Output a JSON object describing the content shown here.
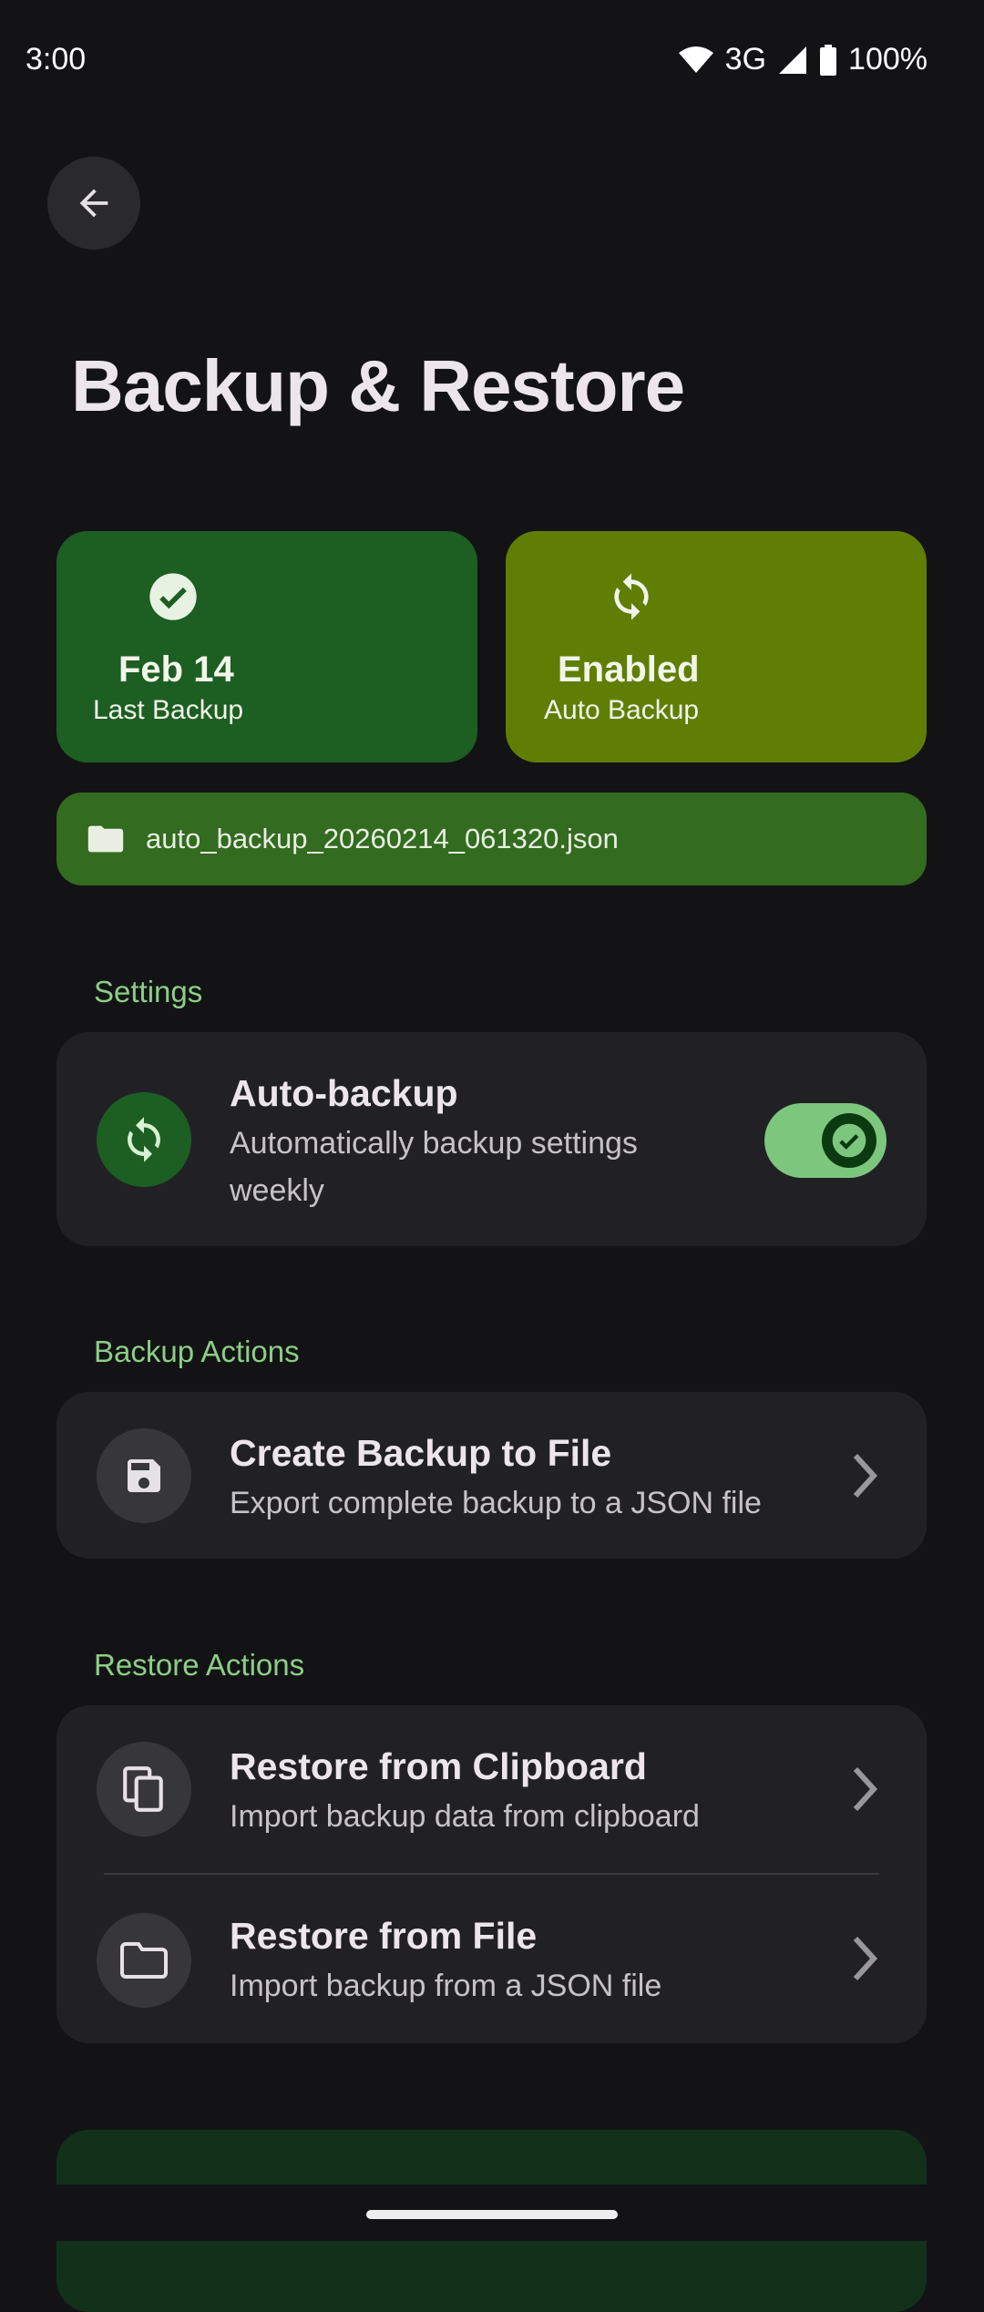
{
  "status_bar": {
    "time": "3:00",
    "network": "3G",
    "battery": "100%"
  },
  "header": {
    "title": "Backup & Restore"
  },
  "stats": {
    "last_backup": {
      "value": "Feb 14",
      "label": "Last Backup",
      "icon": "check-circle-icon",
      "color": "#1d5e22"
    },
    "auto_backup": {
      "value": "Enabled",
      "label": "Auto Backup",
      "icon": "sync-icon",
      "color": "#5f7e03"
    }
  },
  "file": {
    "name": "auto_backup_20260214_061320.json",
    "icon": "folder-icon"
  },
  "settings": {
    "label": "Settings",
    "auto_backup": {
      "title": "Auto-backup",
      "subtitle_line1": "Automatically backup settings",
      "subtitle_line2": "weekly",
      "enabled": true
    }
  },
  "backup_actions": {
    "label": "Backup Actions",
    "items": [
      {
        "title": "Create Backup to File",
        "subtitle": "Export complete backup to a JSON file",
        "icon": "save-icon"
      }
    ]
  },
  "restore_actions": {
    "label": "Restore Actions",
    "items": [
      {
        "title": "Restore from Clipboard",
        "subtitle": "Import backup data from clipboard",
        "icon": "copy-icon"
      },
      {
        "title": "Restore from File",
        "subtitle": "Import backup from a JSON file",
        "icon": "folder-outline-icon"
      }
    ]
  },
  "colors": {
    "accent": "#8cce86",
    "background": "#131316",
    "panel": "#212125"
  }
}
